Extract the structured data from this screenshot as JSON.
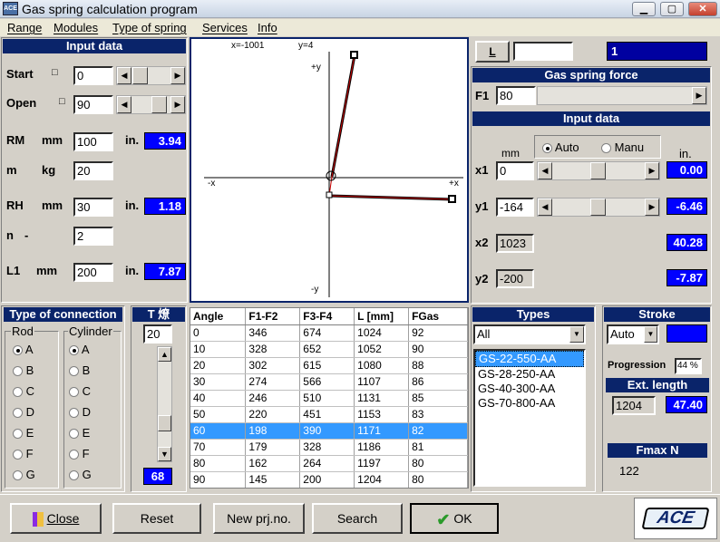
{
  "window": {
    "title": "Gas spring calculation program",
    "icon_label": "ACE"
  },
  "menu": [
    "Range",
    "Modules",
    "Type of spring",
    "Services",
    "Info"
  ],
  "input_data_left": {
    "header": "Input data",
    "start": {
      "label": "Start",
      "unit_icon": "□",
      "value": "0"
    },
    "open": {
      "label": "Open",
      "unit_icon": "□",
      "value": "90"
    },
    "rm": {
      "label": "RM",
      "unit": "mm",
      "value": "100",
      "in_label": "in.",
      "in_value": "3.94"
    },
    "m": {
      "label": "m",
      "unit": "kg",
      "value": "20"
    },
    "rh": {
      "label": "RH",
      "unit": "mm",
      "value": "30",
      "in_label": "in.",
      "in_value": "1.18"
    },
    "n": {
      "label": "n",
      "unit": "-",
      "value": "2"
    },
    "l1": {
      "label": "L1",
      "unit": "mm",
      "value": "200",
      "in_label": "in.",
      "in_value": "7.87"
    }
  },
  "graph": {
    "x_readout": "x=-1001",
    "y_readout": "y=4",
    "plus_y": "+y",
    "minus_y": "-y",
    "minus_x": "-x",
    "plus_x": "+x"
  },
  "right": {
    "l_button": "L",
    "l_field": "",
    "index_field": "1",
    "gas_force_header": "Gas spring force",
    "f1_label": "F1",
    "f1_value": "80",
    "input_header": "Input data",
    "mm_label": "mm",
    "in_label": "in.",
    "auto_label": "Auto",
    "manu_label": "Manu",
    "x1": {
      "label": "x1",
      "value": "0",
      "in_value": "0.00"
    },
    "y1": {
      "label": "y1",
      "value": "-164",
      "in_value": "-6.46"
    },
    "x2": {
      "label": "x2",
      "value": "1023",
      "in_value": "40.28"
    },
    "y2": {
      "label": "y2",
      "value": "-200",
      "in_value": "-7.87"
    }
  },
  "connection": {
    "header": "Type of connection",
    "rod_label": "Rod",
    "cyl_label": "Cylinder",
    "options": [
      "A",
      "B",
      "C",
      "D",
      "E",
      "F",
      "G"
    ],
    "rod_selected": "A",
    "cyl_selected": "A"
  },
  "temp": {
    "header": "T 燎",
    "value": "20",
    "bottom_value": "68"
  },
  "table": {
    "headers": [
      "Angle",
      "F1-F2",
      "F3-F4",
      "L [mm]",
      "FGas"
    ],
    "rows": [
      [
        "0",
        "346",
        "674",
        "1024",
        "92"
      ],
      [
        "10",
        "328",
        "652",
        "1052",
        "90"
      ],
      [
        "20",
        "302",
        "615",
        "1080",
        "88"
      ],
      [
        "30",
        "274",
        "566",
        "1107",
        "86"
      ],
      [
        "40",
        "246",
        "510",
        "1131",
        "85"
      ],
      [
        "50",
        "220",
        "451",
        "1153",
        "83"
      ],
      [
        "60",
        "198",
        "390",
        "1171",
        "82"
      ],
      [
        "70",
        "179",
        "328",
        "1186",
        "81"
      ],
      [
        "80",
        "162",
        "264",
        "1197",
        "80"
      ],
      [
        "90",
        "145",
        "200",
        "1204",
        "80"
      ]
    ],
    "selected_row": 6
  },
  "types": {
    "header": "Types",
    "filter": "All",
    "items": [
      "GS-22-550-AA",
      "GS-28-250-AA",
      "GS-40-300-AA",
      "GS-70-800-AA"
    ],
    "selected": 0
  },
  "stroke": {
    "header": "Stroke",
    "mode": "Auto",
    "value": "",
    "progression_label": "Progression",
    "progression_value": "44 %",
    "ext_header": "Ext. length",
    "ext_mm": "1204",
    "ext_in": "47.40",
    "fmax_header": "Fmax N",
    "fmax_value": "122"
  },
  "buttons": {
    "close": "Close",
    "reset": "Reset",
    "new": "New prj.no.",
    "search": "Search",
    "ok": "OK"
  },
  "logo": "ACE",
  "colors": {
    "header_bg": "#0a246a",
    "value_bg": "#0000ff",
    "select": "#3399ff"
  }
}
